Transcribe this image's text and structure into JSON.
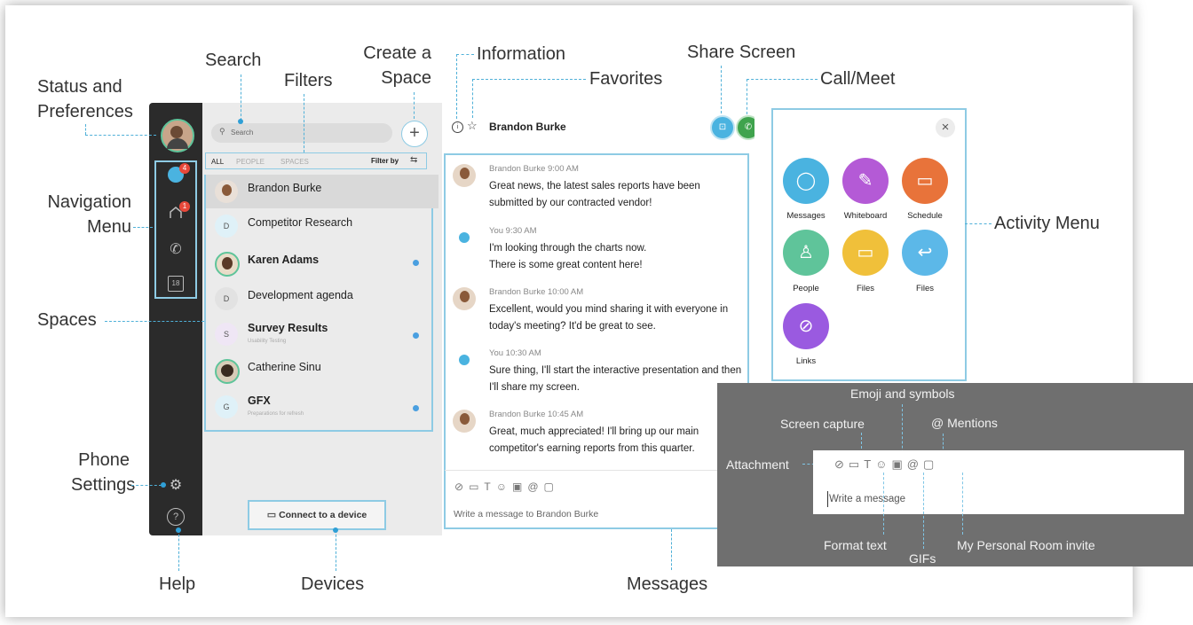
{
  "callouts": {
    "status": "Status and\nPreferences",
    "navigation": "Navigation\nMenu",
    "spaces": "Spaces",
    "phone": "Phone\nSettings",
    "help": "Help",
    "search": "Search",
    "filters": "Filters",
    "create": "Create a\nSpace",
    "information": "Information",
    "favorites": "Favorites",
    "share": "Share Screen",
    "callmeet": "Call/Meet",
    "activity": "Activity Menu",
    "devices": "Devices",
    "messages": "Messages"
  },
  "nav": {
    "msg_badge": "4",
    "team_badge": "1",
    "calendar": "18",
    "help": "?"
  },
  "list": {
    "search_placeholder": "Search",
    "filters": {
      "all": "ALL",
      "people": "PEOPLE",
      "spaces": "SPACES",
      "filter_by": "Filter by"
    },
    "spaces": [
      {
        "name": "Brandon Burke",
        "initial": "",
        "sub": ""
      },
      {
        "name": "Competitor Research",
        "initial": "D",
        "sub": ""
      },
      {
        "name": "Karen Adams",
        "initial": "",
        "sub": ""
      },
      {
        "name": "Development agenda",
        "initial": "D",
        "sub": ""
      },
      {
        "name": "Survey Results",
        "initial": "S",
        "sub": "Usability Testing"
      },
      {
        "name": "Catherine Sinu",
        "initial": "",
        "sub": ""
      },
      {
        "name": "GFX",
        "initial": "G",
        "sub": "Preparations for refresh"
      }
    ],
    "connect": "Connect to a device"
  },
  "chat": {
    "title": "Brandon Burke",
    "messages": [
      {
        "meta": "Brandon Burke  9:00 AM",
        "text": "Great news, the latest sales reports have been submitted by our contracted vendor!"
      },
      {
        "meta": "You   9:30 AM",
        "text": "I'm looking through the charts now.\nThere is some great content here!"
      },
      {
        "meta": "Brandon Burke  10:00 AM",
        "text": "Excellent, would you mind sharing it with everyone in today's meeting? It'd be great to see."
      },
      {
        "meta": "You   10:30 AM",
        "text": "Sure thing, I'll start the interactive presentation and then I'll share my screen."
      },
      {
        "meta": "Brandon Burke  10:45 AM",
        "text": "Great, much appreciated! I'll bring up our main competitor's earning reports from this quarter."
      }
    ],
    "compose_placeholder": "Write a message to Brandon Burke"
  },
  "activity_menu": {
    "close": "×",
    "items": [
      {
        "label": "Messages",
        "color": "#4ab3e0"
      },
      {
        "label": "Whiteboard",
        "color": "#b45ad6"
      },
      {
        "label": "Schedule",
        "color": "#e8733a"
      },
      {
        "label": "People",
        "color": "#5fc49a"
      },
      {
        "label": "Files",
        "color": "#f0c03a"
      },
      {
        "label": "Files",
        "color": "#5cb8e8"
      },
      {
        "label": "Links",
        "color": "#9a5ae0"
      }
    ]
  },
  "compose_detail": {
    "emoji": "Emoji and symbols",
    "screen_capture": "Screen capture",
    "mentions": "@ Mentions",
    "attachment": "Attachment",
    "placeholder": "Write a message",
    "format": "Format text",
    "gifs": "GIFs",
    "personal_room": "My Personal Room invite"
  }
}
